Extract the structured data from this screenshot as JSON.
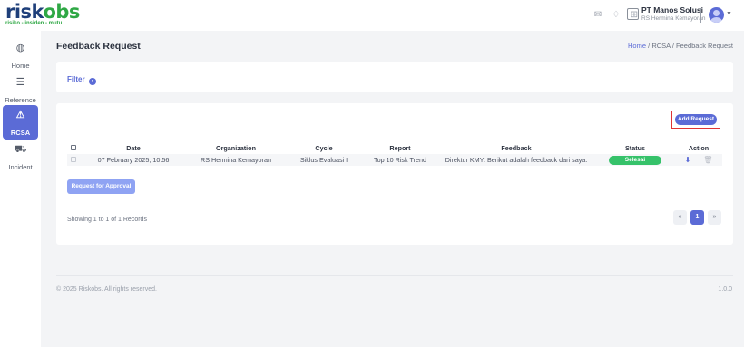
{
  "brand": {
    "name_a": "risk",
    "name_b": "obs",
    "tagline": "risiko - insiden - mutu"
  },
  "topbar": {
    "icons": [
      "mail-icon",
      "bell-icon",
      "grid-icon"
    ],
    "org_name": "PT Manos Solusi",
    "org_sub": "RS Hermina Kemayoran"
  },
  "sidebar": {
    "items": [
      {
        "label": "Home",
        "icon": "palette-icon",
        "active": false
      },
      {
        "label": "Reference",
        "icon": "sliders-icon",
        "active": false
      },
      {
        "label": "RCSA",
        "icon": "warning-icon",
        "active": true
      },
      {
        "label": "Incident",
        "icon": "car-crash-icon",
        "active": false
      }
    ]
  },
  "page": {
    "title": "Feedback Request",
    "breadcrumb": {
      "home": "Home",
      "sep1": "/",
      "section": "RCSA",
      "sep2": "/",
      "current": "Feedback Request"
    }
  },
  "filter": {
    "label": "Filter"
  },
  "actions": {
    "add_label": "Add Request",
    "approve_label": "Request for Approval"
  },
  "table": {
    "columns": [
      "Date",
      "Organization",
      "Cycle",
      "Report",
      "Feedback",
      "Status",
      "Action"
    ],
    "rows": [
      {
        "date": "07 February 2025, 10:56",
        "organization": "RS Hermina Kemayoran",
        "cycle": "Siklus Evaluasi I",
        "report": "Top 10 Risk Trend",
        "feedback": "Direktur KMY: Berikut adalah feedback dari saya.",
        "status": "Selesai"
      }
    ]
  },
  "pagination": {
    "summary": "Showing 1 to 1 of 1 Records",
    "prev": "«",
    "current": "1",
    "next": "»"
  },
  "footer": {
    "copyright": "© 2025 Riskobs. All rights reserved.",
    "version": "1.0.0"
  },
  "colors": {
    "accent": "#5b6bd6",
    "success": "#36c26a",
    "brand_blue": "#1f3f7a",
    "brand_green": "#2fa845",
    "highlight": "#e03434"
  }
}
